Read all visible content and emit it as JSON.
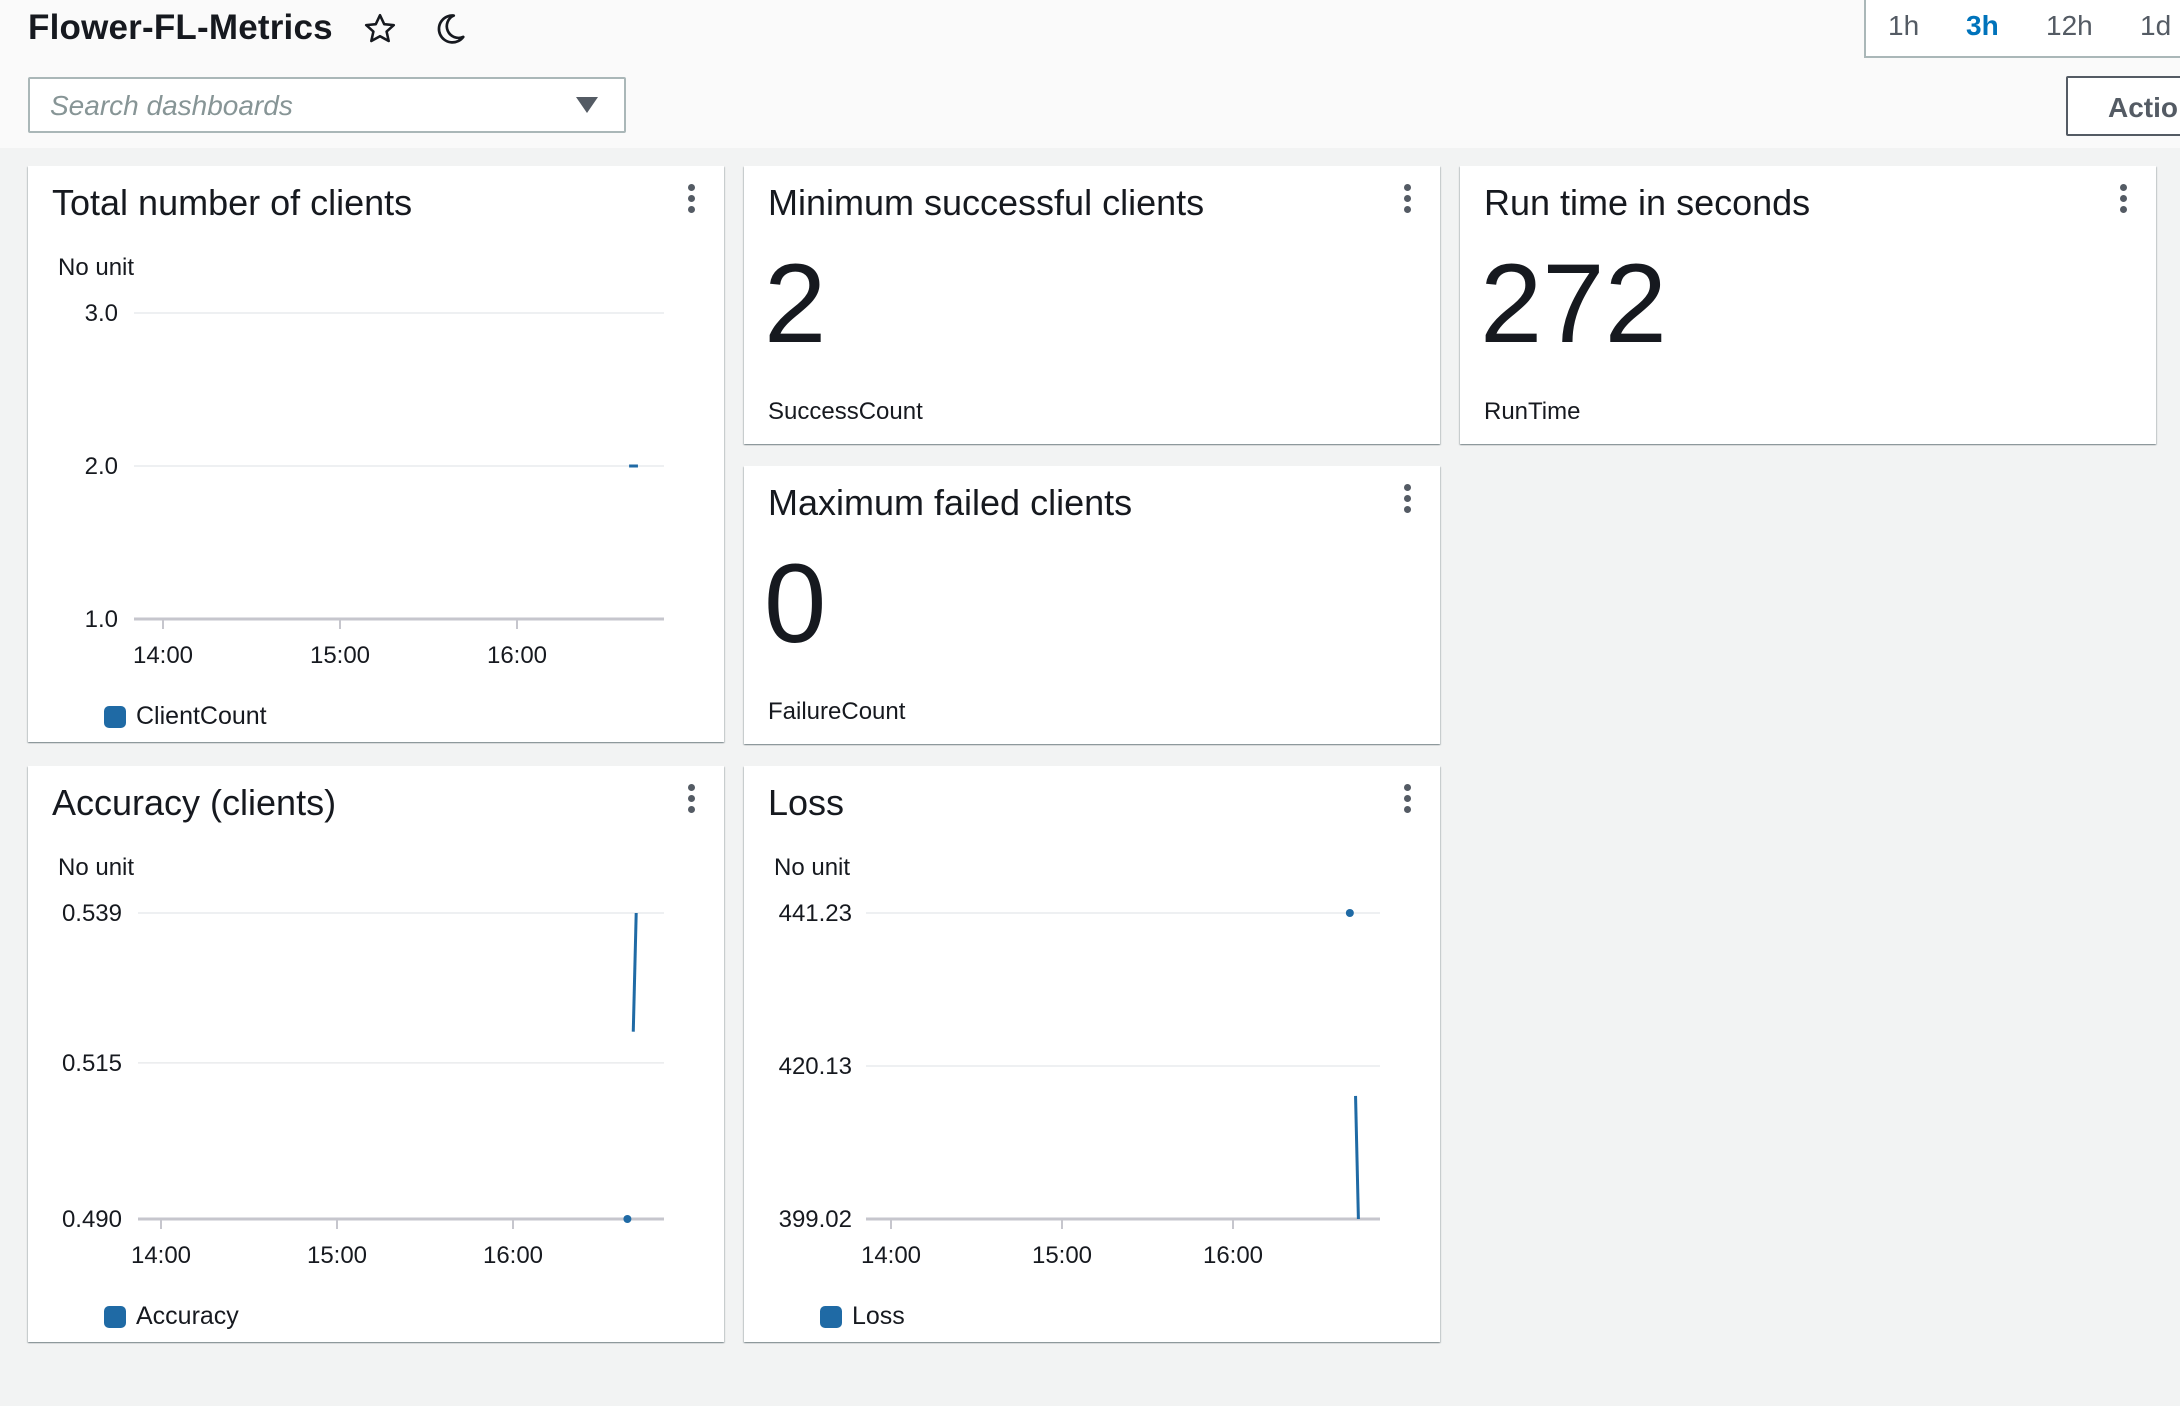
{
  "dashboard": {
    "title": "Flower-FL-Metrics",
    "search_placeholder": "Search dashboards",
    "time_ranges": [
      "1h",
      "3h",
      "12h",
      "1d"
    ],
    "active_range": "3h",
    "actions_label": "Actio"
  },
  "colors": {
    "series": "#1f6aa5",
    "grid": "#e9ebed",
    "axis": "#c6c6cd"
  },
  "widgets": {
    "total_clients": {
      "title": "Total number of clients",
      "unit": "No unit",
      "legend": "ClientCount",
      "chart_data": {
        "type": "line",
        "ylim": [
          1.0,
          3.0
        ],
        "y_ticks": [
          "3.0",
          "2.0",
          "1.0"
        ],
        "x_ticks": [
          "14:00",
          "15:00",
          "16:00"
        ],
        "series": [
          {
            "name": "ClientCount",
            "points": [
              {
                "x": "16:38",
                "y": 2.0
              },
              {
                "x": "16:41",
                "y": 2.0
              }
            ]
          }
        ]
      }
    },
    "min_success": {
      "title": "Minimum successful clients",
      "value": "2",
      "metric": "SuccessCount"
    },
    "run_time": {
      "title": "Run time in seconds",
      "value": "272",
      "metric": "RunTime"
    },
    "max_failed": {
      "title": "Maximum failed clients",
      "value": "0",
      "metric": "FailureCount"
    },
    "accuracy": {
      "title": "Accuracy (clients)",
      "unit": "No unit",
      "legend": "Accuracy",
      "chart_data": {
        "type": "line",
        "ylim": [
          0.49,
          0.539
        ],
        "y_ticks": [
          "0.539",
          "0.515",
          "0.490"
        ],
        "x_ticks": [
          "14:00",
          "15:00",
          "16:00"
        ],
        "series": [
          {
            "name": "Accuracy",
            "points": [
              {
                "x": "16:39",
                "y": 0.49
              },
              {
                "x": "16:41",
                "y": 0.52
              },
              {
                "x": "16:42",
                "y": 0.539
              }
            ]
          }
        ]
      }
    },
    "loss": {
      "title": "Loss",
      "unit": "No unit",
      "legend": "Loss",
      "chart_data": {
        "type": "line",
        "ylim": [
          399.02,
          441.23
        ],
        "y_ticks": [
          "441.23",
          "420.13",
          "399.02"
        ],
        "x_ticks": [
          "14:00",
          "15:00",
          "16:00"
        ],
        "series": [
          {
            "name": "Loss",
            "points": [
              {
                "x": "16:41",
                "y": 441.23
              },
              {
                "x": "16:43",
                "y": 416.0
              },
              {
                "x": "16:44",
                "y": 399.02
              }
            ]
          }
        ]
      }
    }
  }
}
